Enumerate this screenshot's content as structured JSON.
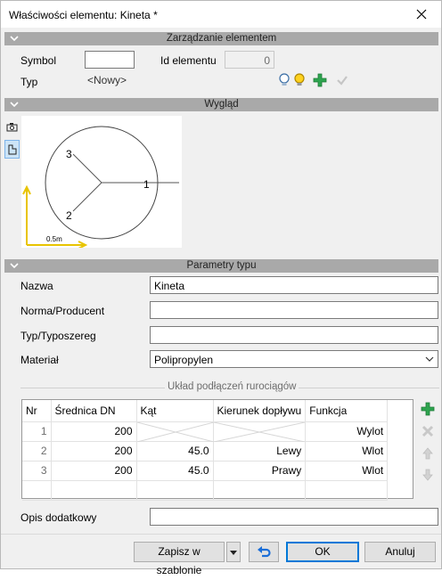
{
  "window": {
    "title": "Właściwości elementu: Kineta *"
  },
  "sections": {
    "management": "Zarządzanie elementem",
    "appearance": "Wygląd",
    "type_params": "Parametry typu"
  },
  "management": {
    "symbol_label": "Symbol",
    "symbol_value": "",
    "id_label": "Id elementu",
    "id_value": "0",
    "type_label": "Typ",
    "type_value": "<Nowy>"
  },
  "preview": {
    "outlet_labels": [
      "1",
      "2",
      "3"
    ],
    "scale_label": "0.5m"
  },
  "type_params": {
    "name_label": "Nazwa",
    "name_value": "Kineta",
    "norm_label": "Norma/Producent",
    "norm_value": "",
    "series_label": "Typ/Typoszereg",
    "series_value": "",
    "material_label": "Materiał",
    "material_value": "Polipropylen"
  },
  "connections": {
    "group_title": "Układ podłączeń rurociągów",
    "columns": [
      "Nr",
      "Średnica DN",
      "Kąt",
      "Kierunek dopływu",
      "Funkcja"
    ],
    "rows": [
      {
        "nr": "1",
        "dn": "200",
        "angle": "",
        "direction": "",
        "function": "Wylot"
      },
      {
        "nr": "2",
        "dn": "200",
        "angle": "45.0",
        "direction": "Lewy",
        "function": "Wlot"
      },
      {
        "nr": "3",
        "dn": "200",
        "angle": "45.0",
        "direction": "Prawy",
        "function": "Wlot"
      }
    ]
  },
  "extra": {
    "label": "Opis dodatkowy",
    "value": ""
  },
  "footer": {
    "save_template": "Zapisz w szablonie",
    "ok": "OK",
    "cancel": "Anuluj"
  },
  "colors": {
    "accent": "#0078d7",
    "header_bar": "#a9a9a9",
    "add_green": "#2ea44f",
    "axis_yellow": "#e8c400"
  },
  "icons": [
    "close-icon",
    "chevron-down-icon",
    "bulb-blue-icon",
    "bulb-yellow-icon",
    "add-icon",
    "check-icon",
    "camera-icon",
    "shape-icon",
    "delete-icon",
    "arrow-up-icon",
    "arrow-down-icon",
    "undo-icon",
    "dropdown-arrow-icon"
  ]
}
